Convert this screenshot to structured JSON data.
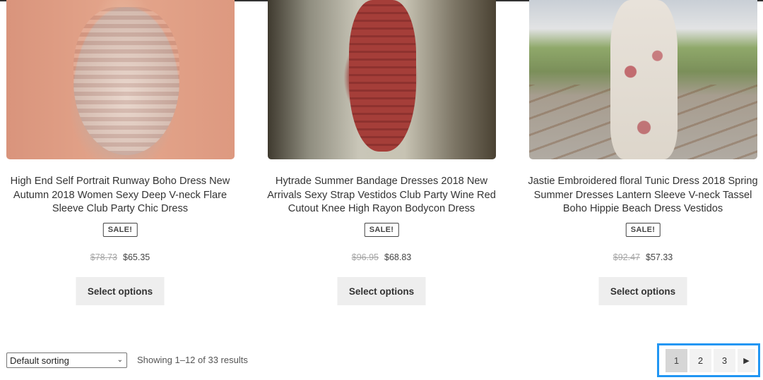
{
  "products": [
    {
      "title": "High End Self Portrait Runway Boho Dress New Autumn 2018 Women Sexy Deep V-neck Flare Sleeve Club Party Chic Dress",
      "badge": "SALE!",
      "old_price": "$78.73",
      "price": "$65.35",
      "button": "Select options"
    },
    {
      "title": "Hytrade Summer Bandage Dresses 2018 New Arrivals Sexy Strap Vestidos Club Party Wine Red Cutout Knee High Rayon Bodycon Dress",
      "badge": "SALE!",
      "old_price": "$96.95",
      "price": "$68.83",
      "button": "Select options"
    },
    {
      "title": "Jastie Embroidered floral Tunic Dress 2018 Spring Summer Dresses Lantern Sleeve V-neck Tassel Boho Hippie Beach Dress Vestidos",
      "badge": "SALE!",
      "old_price": "$92.47",
      "price": "$57.33",
      "button": "Select options"
    }
  ],
  "toolbar": {
    "sorting_selected": "Default sorting",
    "results_text": "Showing 1–12 of 33 results"
  },
  "pagination": {
    "pages": [
      "1",
      "2",
      "3"
    ],
    "current": "1",
    "next_icon": "next-arrow-icon",
    "highlight_color": "#2196f3"
  }
}
